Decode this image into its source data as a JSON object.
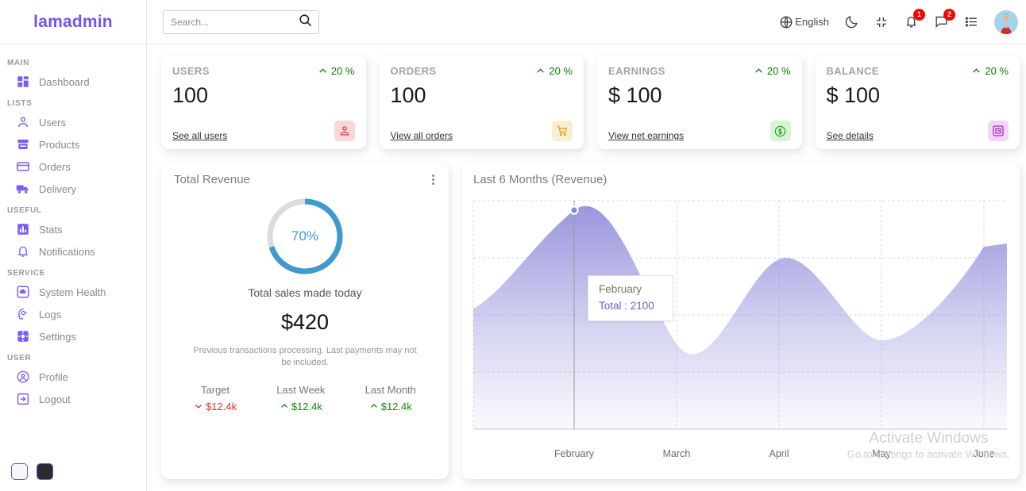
{
  "brand": {
    "name": "lamadmin"
  },
  "sidebar": {
    "sections": [
      {
        "title": "MAIN",
        "items": [
          {
            "label": "Dashboard",
            "icon": "dashboard-icon"
          }
        ]
      },
      {
        "title": "LISTS",
        "items": [
          {
            "label": "Users",
            "icon": "person-icon"
          },
          {
            "label": "Products",
            "icon": "store-icon"
          },
          {
            "label": "Orders",
            "icon": "credit-card-icon"
          },
          {
            "label": "Delivery",
            "icon": "truck-icon"
          }
        ]
      },
      {
        "title": "USEFUL",
        "items": [
          {
            "label": "Stats",
            "icon": "bar-chart-icon"
          },
          {
            "label": "Notifications",
            "icon": "bell-icon"
          }
        ]
      },
      {
        "title": "SERVICE",
        "items": [
          {
            "label": "System Health",
            "icon": "cloud-icon"
          },
          {
            "label": "Logs",
            "icon": "psychology-icon"
          },
          {
            "label": "Settings",
            "icon": "settings-icon"
          }
        ]
      },
      {
        "title": "USER",
        "items": [
          {
            "label": "Profile",
            "icon": "account-circle-icon"
          },
          {
            "label": "Logout",
            "icon": "exit-icon"
          }
        ]
      }
    ],
    "theme_options": [
      {
        "name": "light-theme-swatch",
        "color": "#f7f7f7"
      },
      {
        "name": "dark-theme-swatch",
        "color": "#2b2b2b"
      }
    ]
  },
  "navbar": {
    "search": {
      "placeholder": "Search...",
      "value": ""
    },
    "language": "English",
    "notifications_count": "1",
    "messages_count": "2"
  },
  "widgets": [
    {
      "title": "USERS",
      "percentage": "20 %",
      "counter": "100",
      "link": "See all users",
      "icon": "person-outline-icon",
      "icon_bg": "#fbd8d8",
      "icon_color": "#d93c5e"
    },
    {
      "title": "ORDERS",
      "percentage": "20 %",
      "counter": "100",
      "link": "View all orders",
      "icon": "shopping-cart-icon",
      "icon_bg": "#faeed2",
      "icon_color": "#daa521"
    },
    {
      "title": "EARNINGS",
      "percentage": "20 %",
      "counter": "$ 100",
      "link": "View net earnings",
      "icon": "monetization-icon",
      "icon_bg": "#d6f5d6",
      "icon_color": "#2aa32a"
    },
    {
      "title": "BALANCE",
      "percentage": "20 %",
      "counter": "$ 100",
      "link": "See details",
      "icon": "account-balance-icon",
      "icon_bg": "#f2d6f7",
      "icon_color": "#a72bbd"
    }
  ],
  "featured": {
    "title": "Total Revenue",
    "percentage": "70%",
    "subtitle": "Total sales made today",
    "amount": "$420",
    "description": "Previous transactions processing. Last payments may not be included.",
    "summary": [
      {
        "title": "Target",
        "value": "$12.4k",
        "direction": "down"
      },
      {
        "title": "Last Week",
        "value": "$12.4k",
        "direction": "up"
      },
      {
        "title": "Last Month",
        "value": "$12.4k",
        "direction": "up"
      }
    ]
  },
  "chart": {
    "title": "Last 6 Months (Revenue)",
    "tooltip": {
      "label": "February",
      "value": "Total : 2100"
    }
  },
  "chart_data": {
    "type": "area",
    "title": "Last 6 Months (Revenue)",
    "xlabel": "",
    "ylabel": "",
    "categories": [
      "February",
      "March",
      "April",
      "May",
      "June"
    ],
    "series": [
      {
        "name": "Total",
        "values": [
          2100,
          900,
          1700,
          1000,
          1800
        ]
      }
    ],
    "highlight": {
      "category": "February",
      "value": 2100
    },
    "grid": true,
    "legend": false,
    "accent": "#8884d8"
  },
  "watermark": {
    "line1": "Activate Windows",
    "line2": "Go to Settings to activate Windows."
  }
}
